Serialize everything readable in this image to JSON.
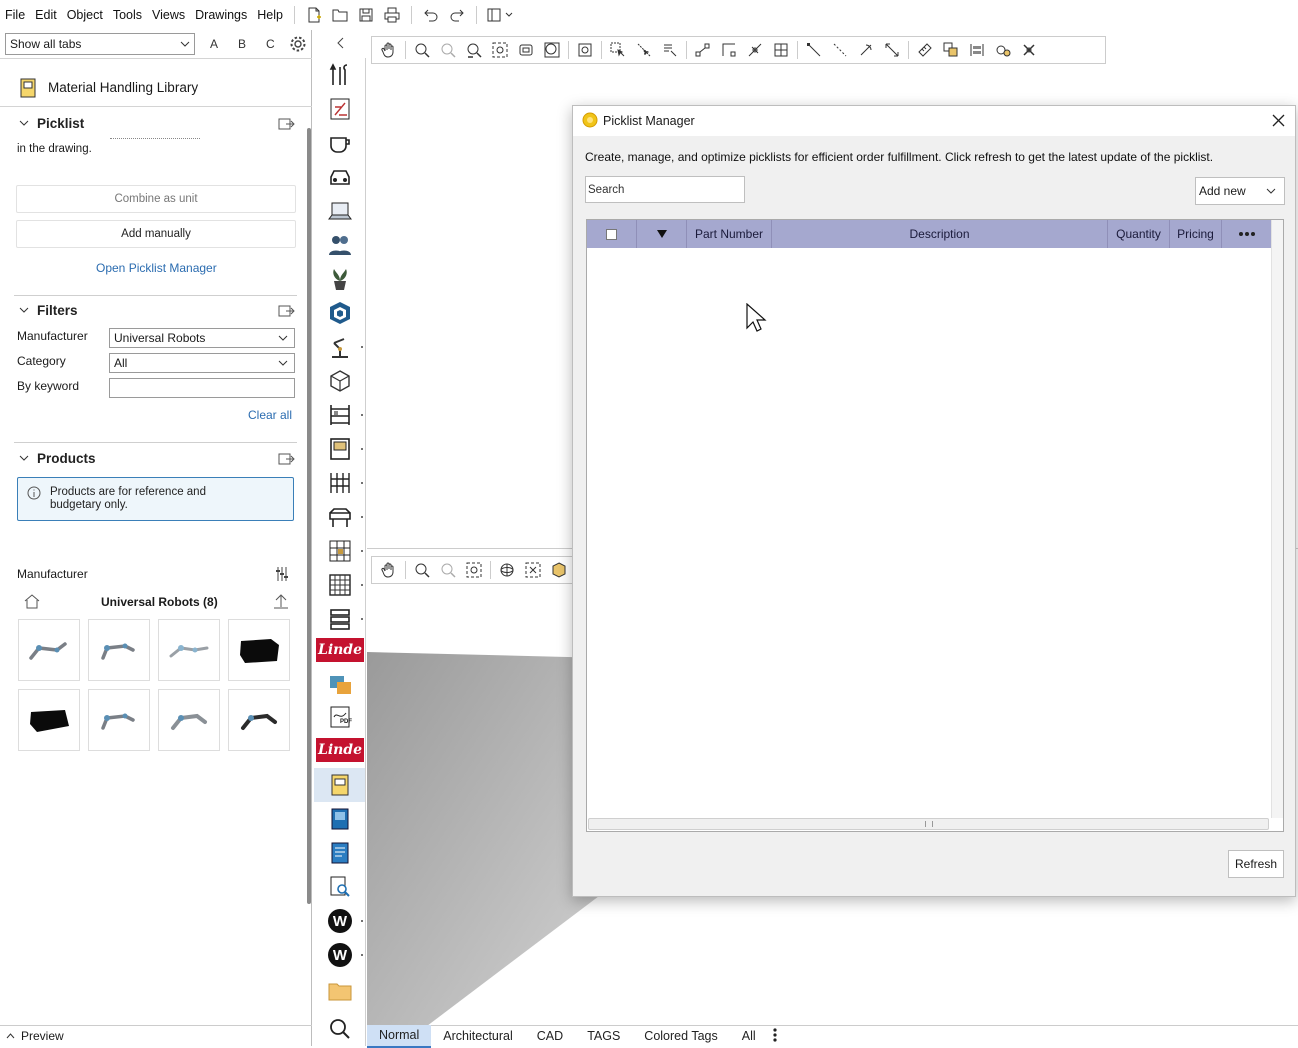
{
  "menu": {
    "items": [
      "File",
      "Edit",
      "Object",
      "Tools",
      "Views",
      "Drawings",
      "Help"
    ]
  },
  "left": {
    "tab_select": "Show all tabs",
    "letters": [
      "A",
      "B",
      "C"
    ],
    "library_title": "Material Handling Library",
    "picklist": {
      "title": "Picklist",
      "clipped_text": "in the drawing.",
      "combine_label": "Combine as unit",
      "add_manual_label": "Add manually",
      "open_manager_label": "Open Picklist Manager"
    },
    "filters": {
      "title": "Filters",
      "manufacturer_label": "Manufacturer",
      "manufacturer_value": "Universal Robots",
      "category_label": "Category",
      "category_value": "All",
      "keyword_label": "By keyword",
      "keyword_value": "",
      "clear_label": "Clear all"
    },
    "products": {
      "title": "Products",
      "info": "Products are for reference and budgetary only.",
      "manufacturer_heading": "Manufacturer",
      "group_title": "Universal Robots (8)",
      "items": [
        "arm",
        "arm",
        "arm",
        "box",
        "box",
        "arm",
        "arm",
        "arm"
      ]
    },
    "preview_label": "Preview"
  },
  "strip": {
    "icons": [
      "tools-icon",
      "drawing-icon",
      "coffee-icon",
      "car-icon",
      "laptop-icon",
      "people-icon",
      "plant-icon",
      "sketchup-icon",
      "arm-icon",
      "cube-icon",
      "shelf-icon",
      "door-icon",
      "rack-icon",
      "gate-icon",
      "crate-icon",
      "grid-rack-icon",
      "stack-icon",
      "linde-logo",
      "color-icon",
      "pdf-icon",
      "linde-logo",
      "catalog-icon",
      "book-icon",
      "book2-icon",
      "search-doc-icon",
      "w-icon",
      "w-icon",
      "folder-icon",
      "search-icon"
    ],
    "linde_text": "Linde",
    "pdf_text": "PDF",
    "w_text": "W"
  },
  "bottom_tabs": [
    "Normal",
    "Architectural",
    "CAD",
    "TAGS",
    "Colored Tags",
    "All"
  ],
  "dialog": {
    "title": "Picklist Manager",
    "description": "Create, manage, and optimize picklists for efficient order fulfillment. Click refresh to get the latest update of the picklist.",
    "search_placeholder": "Search",
    "add_new_label": "Add new",
    "columns": [
      "Part Number",
      "Description",
      "Quantity",
      "Pricing"
    ],
    "refresh_label": "Refresh"
  },
  "colors": {
    "header_bg": "#a5a8cf",
    "accent": "#2b6cb0",
    "linde_red": "#c4122f"
  }
}
